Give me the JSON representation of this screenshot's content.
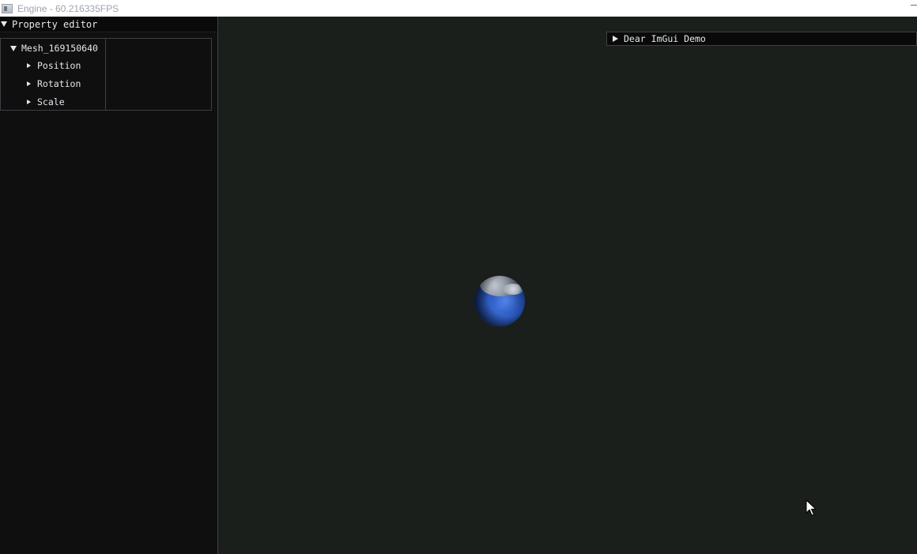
{
  "window": {
    "title": "Engine - 60.216335FPS",
    "icons": [
      "app-icon",
      "minimize-icon"
    ]
  },
  "property_editor": {
    "title": "Property editor",
    "tree": {
      "root": {
        "label": "Mesh_169150640",
        "children": [
          {
            "label": "Position"
          },
          {
            "label": "Rotation"
          },
          {
            "label": "Scale"
          }
        ]
      }
    }
  },
  "viewport": {
    "object": "globe",
    "colors": {
      "background": "#1a1f1b",
      "ocean": "#2a56b8"
    }
  },
  "demo_window": {
    "title": "Dear ImGui Demo"
  },
  "colors": {
    "panel_bg": "#0f0f0f",
    "text": "#e5e7eb",
    "border": "#3f3f46"
  }
}
